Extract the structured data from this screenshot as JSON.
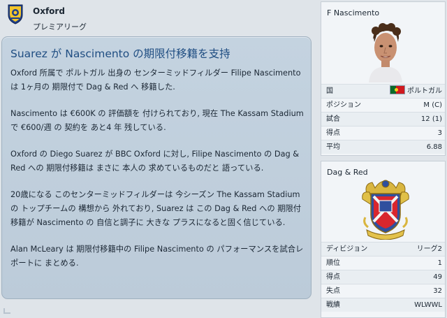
{
  "club": {
    "name": "Oxford",
    "league": "プレミアリーグ"
  },
  "news": {
    "title": "Suarez が Nascimento の期限付移籍を支持",
    "paragraphs": [
      "Oxford 所属で ポルトガル 出身の センターミッドフィルダー Filipe Nascimento は 1ヶ月の 期限付で Dag & Red へ 移籍した.",
      "Nascimento は €600K の 評価額を 付けられており, 現在 The Kassam Stadium で €600/週 の 契約を あと4 年 残している.",
      "Oxford の Diego Suarez が BBC Oxford に対し, Filipe Nascimento の Dag & Red への 期限付移籍は まさに 本人の 求めているものだと 語っている.",
      "20歳になる このセンターミッドフィルダーは 今シーズン The Kassam Stadium の トップチームの 構想から 外れており, Suarez は この Dag & Red への 期限付移籍が Nascimento の 自信と調子に 大きな プラスになると固く信じている.",
      "Alan McLeary は 期限付移籍中の Filipe Nascimento の パフォーマンスを試合レポートに まとめる."
    ]
  },
  "player_card": {
    "name": "F Nascimento",
    "rows": [
      {
        "label": "国",
        "value": "ポルトガル",
        "flag": true
      },
      {
        "label": "ポジション",
        "value": "M (C)"
      },
      {
        "label": "試合",
        "value": "12 (1)"
      },
      {
        "label": "得点",
        "value": "3"
      },
      {
        "label": "平均",
        "value": "6.88"
      }
    ]
  },
  "team_card": {
    "name": "Dag & Red",
    "rows": [
      {
        "label": "ディビジョン",
        "value": "リーグ2"
      },
      {
        "label": "順位",
        "value": "1"
      },
      {
        "label": "得点",
        "value": "49"
      },
      {
        "label": "失点",
        "value": "32"
      },
      {
        "label": "戦績",
        "value": "WLWWL"
      }
    ]
  },
  "icons": {
    "club_badge": "oxford-badge-icon",
    "player_photo": "player-face-icon",
    "team_crest": "dag-red-crest-icon",
    "flag": "portugal-flag-icon"
  },
  "colors": {
    "title": "#1f4d82",
    "panel": "#c4d3e0",
    "background": "#dfe4e9",
    "card": "#f2f5f8"
  }
}
